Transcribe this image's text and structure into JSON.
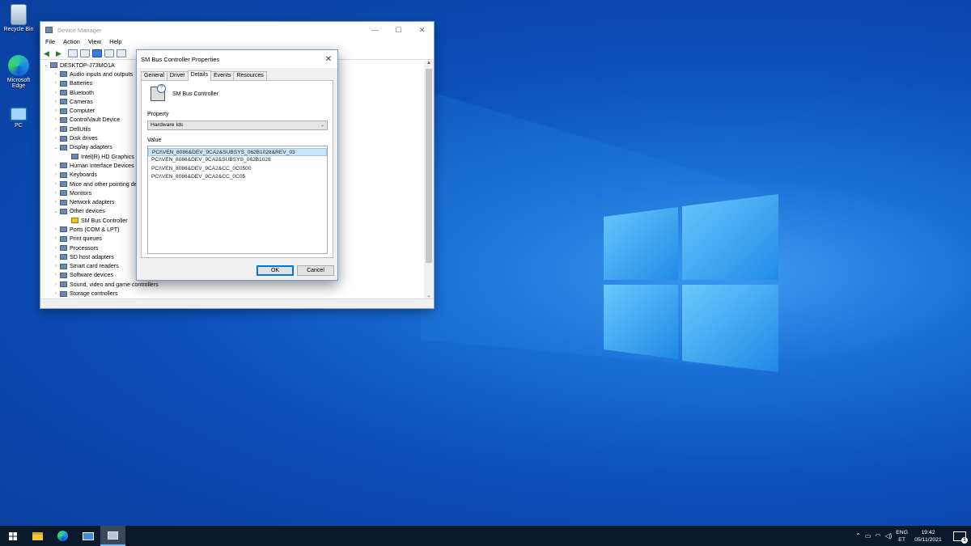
{
  "desktop": {
    "icons": [
      {
        "label": "Recycle Bin",
        "icon": "recycle-bin-icon"
      },
      {
        "label": "Microsoft Edge",
        "icon": "edge-icon"
      },
      {
        "label": "PC",
        "icon": "pc-icon"
      }
    ]
  },
  "device_manager": {
    "title": "Device Manager",
    "menu": [
      "File",
      "Action",
      "View",
      "Help"
    ],
    "tree": [
      {
        "label": "DESKTOP-J73MO1A",
        "depth": 0,
        "expanded": true
      },
      {
        "label": "Audio inputs and outputs",
        "depth": 1
      },
      {
        "label": "Batteries",
        "depth": 1
      },
      {
        "label": "Bluetooth",
        "depth": 1
      },
      {
        "label": "Cameras",
        "depth": 1
      },
      {
        "label": "Computer",
        "depth": 1
      },
      {
        "label": "ControlVault Device",
        "depth": 1
      },
      {
        "label": "DellUtils",
        "depth": 1
      },
      {
        "label": "Disk drives",
        "depth": 1
      },
      {
        "label": "Display adapters",
        "depth": 1,
        "expanded": true
      },
      {
        "label": "Intel(R) HD Graphics",
        "depth": 2
      },
      {
        "label": "Human Interface Devices",
        "depth": 1
      },
      {
        "label": "Keyboards",
        "depth": 1
      },
      {
        "label": "Mice and other pointing devices",
        "depth": 1
      },
      {
        "label": "Monitors",
        "depth": 1
      },
      {
        "label": "Network adapters",
        "depth": 1
      },
      {
        "label": "Other devices",
        "depth": 1,
        "expanded": true
      },
      {
        "label": "SM Bus Controller",
        "depth": 2,
        "warning": true
      },
      {
        "label": "Ports (COM & LPT)",
        "depth": 1
      },
      {
        "label": "Print queues",
        "depth": 1
      },
      {
        "label": "Processors",
        "depth": 1
      },
      {
        "label": "SD host adapters",
        "depth": 1
      },
      {
        "label": "Smart card readers",
        "depth": 1
      },
      {
        "label": "Software devices",
        "depth": 1
      },
      {
        "label": "Sound, video and game controllers",
        "depth": 1
      },
      {
        "label": "Storage controllers",
        "depth": 1
      }
    ]
  },
  "dialog": {
    "title": "SM Bus Controller Properties",
    "tabs": [
      "General",
      "Driver",
      "Details",
      "Events",
      "Resources"
    ],
    "active_tab": "Details",
    "device_name": "SM Bus Controller",
    "property_label": "Property",
    "property_value": "Hardware Ids",
    "value_label": "Value",
    "values": [
      "PCI\\VEN_8086&DEV_9CA2&SUBSYS_062B1028&REV_03",
      "PCI\\VEN_8086&DEV_9CA2&SUBSYS_062B1028",
      "PCI\\VEN_8086&DEV_9CA2&CC_0C0500",
      "PCI\\VEN_8086&DEV_9CA2&CC_0C05"
    ],
    "ok_label": "OK",
    "cancel_label": "Cancel"
  },
  "taskbar": {
    "items": [
      "start-icon",
      "file-explorer-icon",
      "edge-icon",
      "mail-icon",
      "device-manager-icon"
    ],
    "lang_top": "ENG",
    "lang_bottom": "ET",
    "time": "19:42",
    "date": "05/11/2021",
    "notification_count": "1"
  }
}
